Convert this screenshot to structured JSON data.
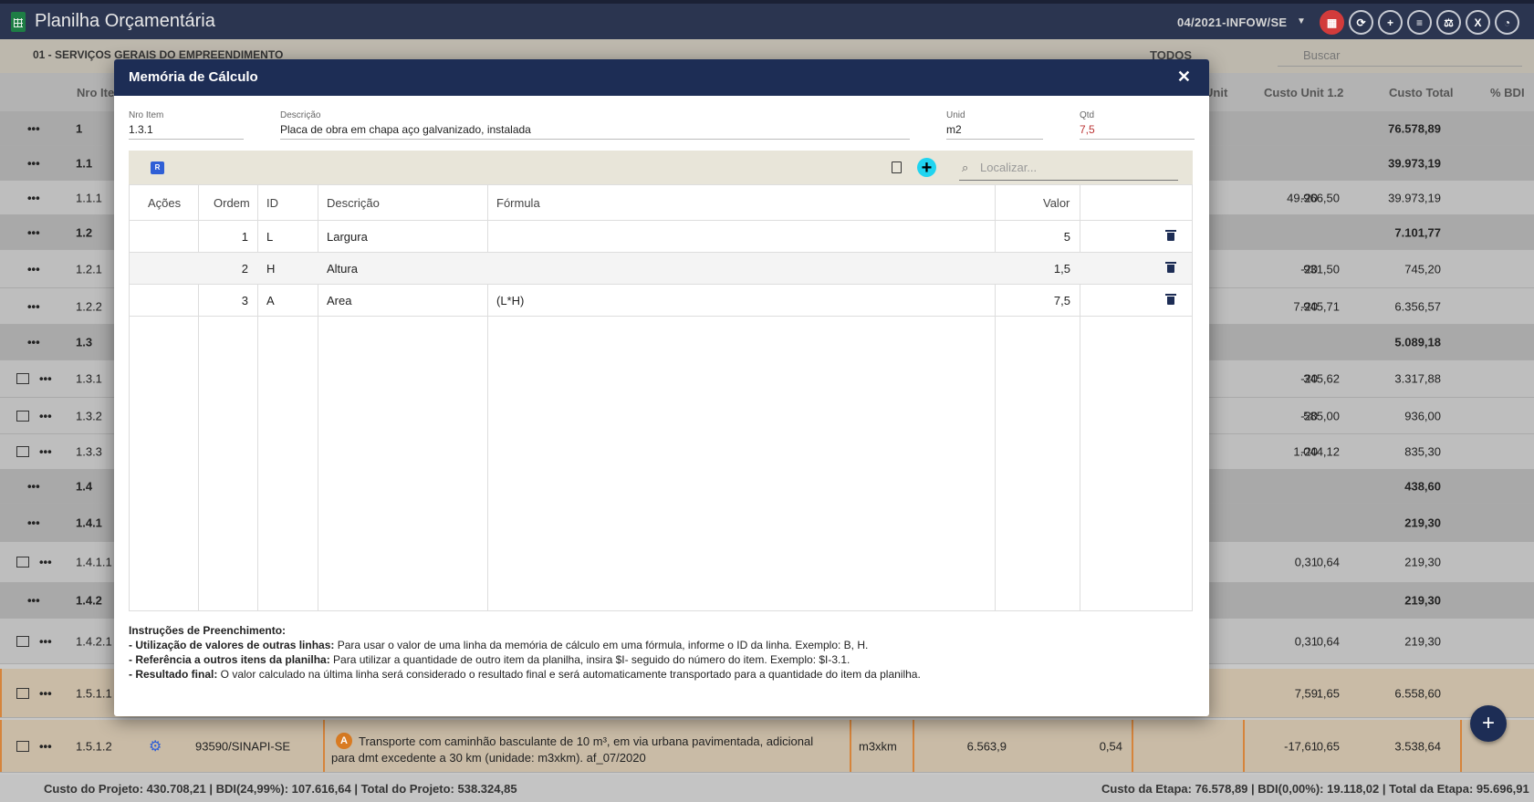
{
  "app": {
    "title": "Planilha Orçamentária",
    "period": "04/2021-INFOW/SE"
  },
  "sheet": {
    "stage_label": "01 - SERVIÇOS GERAIS DO EMPREENDIMENTO",
    "filter_label": "TODOS",
    "search_placeholder": "Buscar",
    "headers": {
      "nro": "Nro Item",
      "unit": "Unit",
      "unit12": "Custo Unit 1.2",
      "total": "Custo Total",
      "bdi": "% BDI"
    },
    "rows": [
      {
        "num": "1",
        "type": "group",
        "sub": "",
        "u12": "",
        "tot": "76.578,89"
      },
      {
        "num": "1.1",
        "type": "group",
        "sub": "",
        "u12": "",
        "tot": "39.973,19"
      },
      {
        "num": "1.1.1",
        "type": "item",
        "sub": "-20",
        "u12": "49.966,50",
        "tot": "39.973,19"
      },
      {
        "num": "1.2",
        "type": "group",
        "sub": "",
        "u12": "",
        "tot": "7.101,77"
      },
      {
        "num": "1.2.1",
        "type": "item",
        "sub": "-20",
        "u12": "931,50",
        "tot": "745,20"
      },
      {
        "num": "1.2.2",
        "type": "item",
        "sub": "-20",
        "u12": "7.945,71",
        "tot": "6.356,57"
      },
      {
        "num": "1.3",
        "type": "group",
        "sub": "",
        "u12": "",
        "tot": "5.089,18"
      },
      {
        "num": "1.3.1",
        "type": "item",
        "sub": "-20",
        "u12": "345,62",
        "tot": "3.317,88"
      },
      {
        "num": "1.3.2",
        "type": "item",
        "sub": "-20",
        "u12": "585,00",
        "tot": "936,00"
      },
      {
        "num": "1.3.3",
        "type": "item",
        "sub": "-20",
        "u12": "1.044,12",
        "tot": "835,30"
      },
      {
        "num": "1.4",
        "type": "group",
        "sub": "",
        "u12": "",
        "tot": "438,60"
      },
      {
        "num": "1.4.1",
        "type": "group",
        "sub": "",
        "u12": "",
        "tot": "219,30"
      },
      {
        "num": "1.4.1.1",
        "type": "item",
        "sub": "0,31",
        "u12": "0,64",
        "tot": "219,30"
      },
      {
        "num": "1.4.2",
        "type": "group",
        "sub": "",
        "u12": "",
        "tot": "219,30"
      },
      {
        "num": "1.4.2.1",
        "type": "item",
        "sub": "0,31",
        "u12": "0,64",
        "tot": "219,30"
      },
      {
        "num": "1.5.1.1",
        "type": "orange",
        "sub": "7,59",
        "u12": "1,65",
        "tot": "6.558,60"
      },
      {
        "num": "1.5.1.2",
        "type": "orange",
        "sub": "-17,61",
        "u12": "0,65",
        "tot": "3.538,64"
      }
    ],
    "last_row": {
      "code": "93590/SINAPI-SE",
      "badge": "A",
      "desc_line1": "Transporte com caminhão basculante de 10 m³, em via urbana pavimentada, adicional",
      "desc_line2": "para dmt excedente a 30 km (unidade: m3xkm). af_07/2020",
      "unit": "m3xkm",
      "qty": "6.563,9",
      "price": "0,54"
    },
    "footer_left": "Custo do Projeto: 430.708,21 | BDI(24,99%): 107.616,64 | Total do Projeto: 538.324,85",
    "footer_right": "Custo da Etapa: 76.578,89 | BDI(0,00%): 19.118,02 | Total da Etapa: 95.696,91"
  },
  "modal": {
    "title": "Memória de Cálculo",
    "close": "✕",
    "fields": {
      "nro_item": {
        "label": "Nro Item",
        "value": "1.3.1"
      },
      "descricao": {
        "label": "Descrição",
        "value": "Placa de obra em chapa aço galvanizado, instalada"
      },
      "unid": {
        "label": "Unid",
        "value": "m2"
      },
      "qtd": {
        "label": "Qtd",
        "value": "7,5"
      }
    },
    "badge": "R",
    "search_placeholder": "Localizar...",
    "columns": {
      "acoes": "Ações",
      "ordem": "Ordem",
      "id": "ID",
      "descricao": "Descrição",
      "formula": "Fórmula",
      "valor": "Valor"
    },
    "rows": [
      {
        "ordem": "1",
        "id": "L",
        "descricao": "Largura",
        "formula": "",
        "valor": "5"
      },
      {
        "ordem": "2",
        "id": "H",
        "descricao": "Altura",
        "formula": "",
        "valor": "1,5"
      },
      {
        "ordem": "3",
        "id": "A",
        "descricao": "Area",
        "formula": "(L*H)",
        "valor": "7,5"
      }
    ],
    "instructions": {
      "title": "Instruções de Preenchimento:",
      "items": [
        {
          "bold": "- Utilização de valores de outras linhas:",
          "text": " Para usar o valor de uma linha da memória de cálculo em uma fórmula, informe o ID da linha. Exemplo: B, H."
        },
        {
          "bold": "- Referência a outros itens da planilha:",
          "text": " Para utilizar a quantidade de outro item da planilha, insira $I- seguido do número do item. Exemplo: $I-3.1."
        },
        {
          "bold": "- Resultado final:",
          "text": " O valor calculado na última linha será considerado o resultado final e será automaticamente transportado para a quantidade do item da planilha."
        }
      ]
    }
  },
  "colors": {
    "header": "#1d2d55",
    "accent_add": "#20d4f0",
    "qtd_red": "#b33333",
    "orange_border": "#d6843b"
  }
}
